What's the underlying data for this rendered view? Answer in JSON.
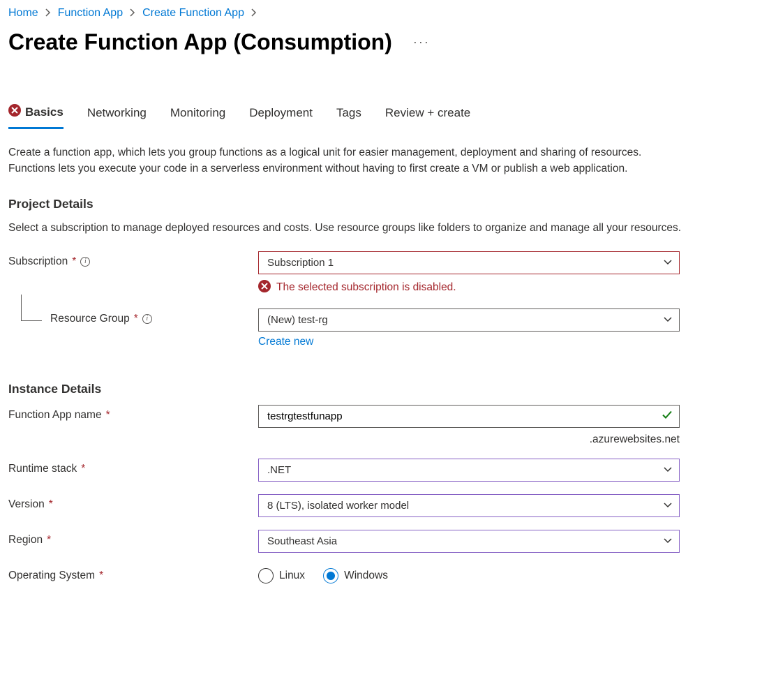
{
  "breadcrumb": {
    "items": [
      "Home",
      "Function App",
      "Create Function App"
    ]
  },
  "title": "Create Function App (Consumption)",
  "tabs": {
    "items": [
      {
        "label": "Basics",
        "active": true,
        "error": true
      },
      {
        "label": "Networking"
      },
      {
        "label": "Monitoring"
      },
      {
        "label": "Deployment"
      },
      {
        "label": "Tags"
      },
      {
        "label": "Review + create"
      }
    ]
  },
  "description": "Create a function app, which lets you group functions as a logical unit for easier management, deployment and sharing of resources. Functions lets you execute your code in a serverless environment without having to first create a VM or publish a web application.",
  "project": {
    "heading": "Project Details",
    "desc": "Select a subscription to manage deployed resources and costs. Use resource groups like folders to organize and manage all your resources.",
    "subscription": {
      "label": "Subscription",
      "value": "Subscription 1",
      "error": "The selected subscription is disabled."
    },
    "resourceGroup": {
      "label": "Resource Group",
      "value": "(New) test-rg",
      "createNew": "Create new"
    }
  },
  "instance": {
    "heading": "Instance Details",
    "appName": {
      "label": "Function App name",
      "value": "testrgtestfunapp",
      "suffix": ".azurewebsites.net"
    },
    "runtime": {
      "label": "Runtime stack",
      "value": ".NET"
    },
    "version": {
      "label": "Version",
      "value": "8 (LTS), isolated worker model"
    },
    "region": {
      "label": "Region",
      "value": "Southeast Asia"
    },
    "os": {
      "label": "Operating System",
      "options": [
        "Linux",
        "Windows"
      ],
      "selected": "Windows"
    }
  }
}
